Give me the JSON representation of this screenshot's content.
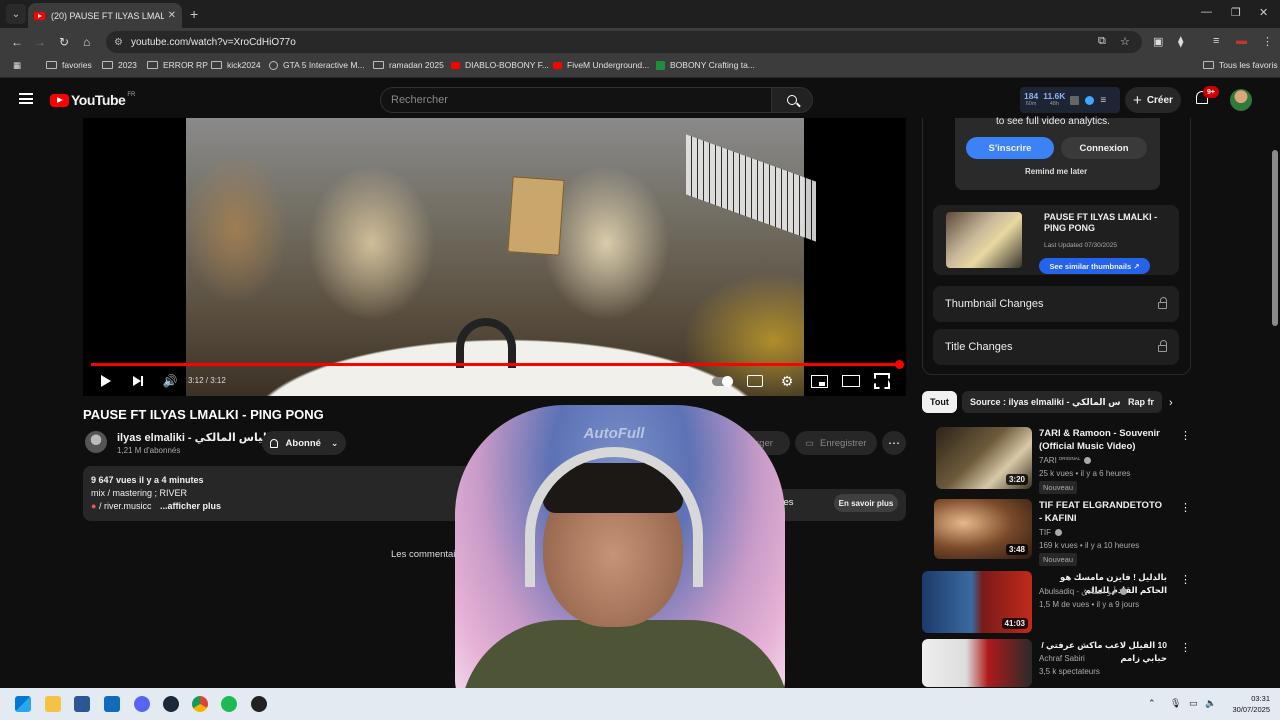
{
  "browser": {
    "tab_title": "(20) PAUSE FT ILYAS LMALKI - P",
    "url": "youtube.com/watch?v=XroCdHiO77o",
    "bookmarks": [
      "favories",
      "2023",
      "ERROR RP",
      "kick2024",
      "GTA 5 Interactive M...",
      "ramadan 2025",
      "DIABLO-BOBONY F...",
      "FiveM Underground...",
      "BOBONY Crafting ta..."
    ],
    "all_favorites": "Tous les favoris"
  },
  "masthead": {
    "logo": "YouTube",
    "country": "FR",
    "search_placeholder": "Rechercher",
    "ext_stat1": "184",
    "ext_stat1_sub": "60m",
    "ext_stat2": "11.6K",
    "ext_stat2_sub": "48h",
    "create_label": "Créer",
    "notif_count": "9+"
  },
  "player": {
    "time": "3:12 / 3:12",
    "progress": 1.0
  },
  "video": {
    "title": "PAUSE FT ILYAS LMALKI - PING PONG",
    "channel": "ilyas elmaliki - الياس المالكي",
    "subscribers": "1,21 M d'abonnés",
    "subscribed_label": "Abonné",
    "download_label": "Télécharger",
    "save_label": "Enregistrer",
    "desc_views": "9 647 vues  il y a 4 minutes",
    "desc_line2": "mix / mastering ; RIVER",
    "desc_link": "/ river.musicc",
    "desc_more": "...afficher plus",
    "promo_text": "et les familles",
    "promo_button": "En savoir plus",
    "comments_note": "Les commentai"
  },
  "extension": {
    "analytics_text": "to see full video analytics.",
    "signup": "S'inscrire",
    "login": "Connexion",
    "remind": "Remind me later",
    "card_title": "PAUSE FT ILYAS LMALKI - PING PONG",
    "card_date": "Last Updated 07/30/2025",
    "card_button": "See similar thumbnails ↗",
    "thumbnail_changes": "Thumbnail Changes",
    "title_changes": "Title Changes"
  },
  "chips": [
    "Tout",
    "Source : ilyas elmaliki - الياس المالكي",
    "Rap fr"
  ],
  "recommendations": [
    {
      "title": "7ARI & Ramoon - Souvenir (Official Music Video)",
      "channel": "7ARI",
      "channel_tag": "ORIGINAL",
      "meta": "25 k vues • il y a 6 heures",
      "badge": "Nouveau",
      "duration": "3:20"
    },
    {
      "title": "TIF FEAT ELGRANDETOTO - KAFINI",
      "channel": "TIF",
      "meta": "169 k vues • il y a 10 heures",
      "badge": "Nouveau",
      "duration": "3:48"
    },
    {
      "title": "بالدليل ! فايزن مامسك هو الحاكم القادم للعالم",
      "channel": "Abulsadiq - أبو الصادق",
      "meta": "1,5 M de vues • il y a 9 jours",
      "duration": "41:03"
    },
    {
      "title": "10 الفيلل لاعب ماكش عرفتي / حبابي زامم",
      "channel": "Achraf Sabiri",
      "meta": "3,5 k spectateurs"
    }
  ],
  "taskbar": {
    "time": "03:31",
    "date": "30/07/2025"
  }
}
